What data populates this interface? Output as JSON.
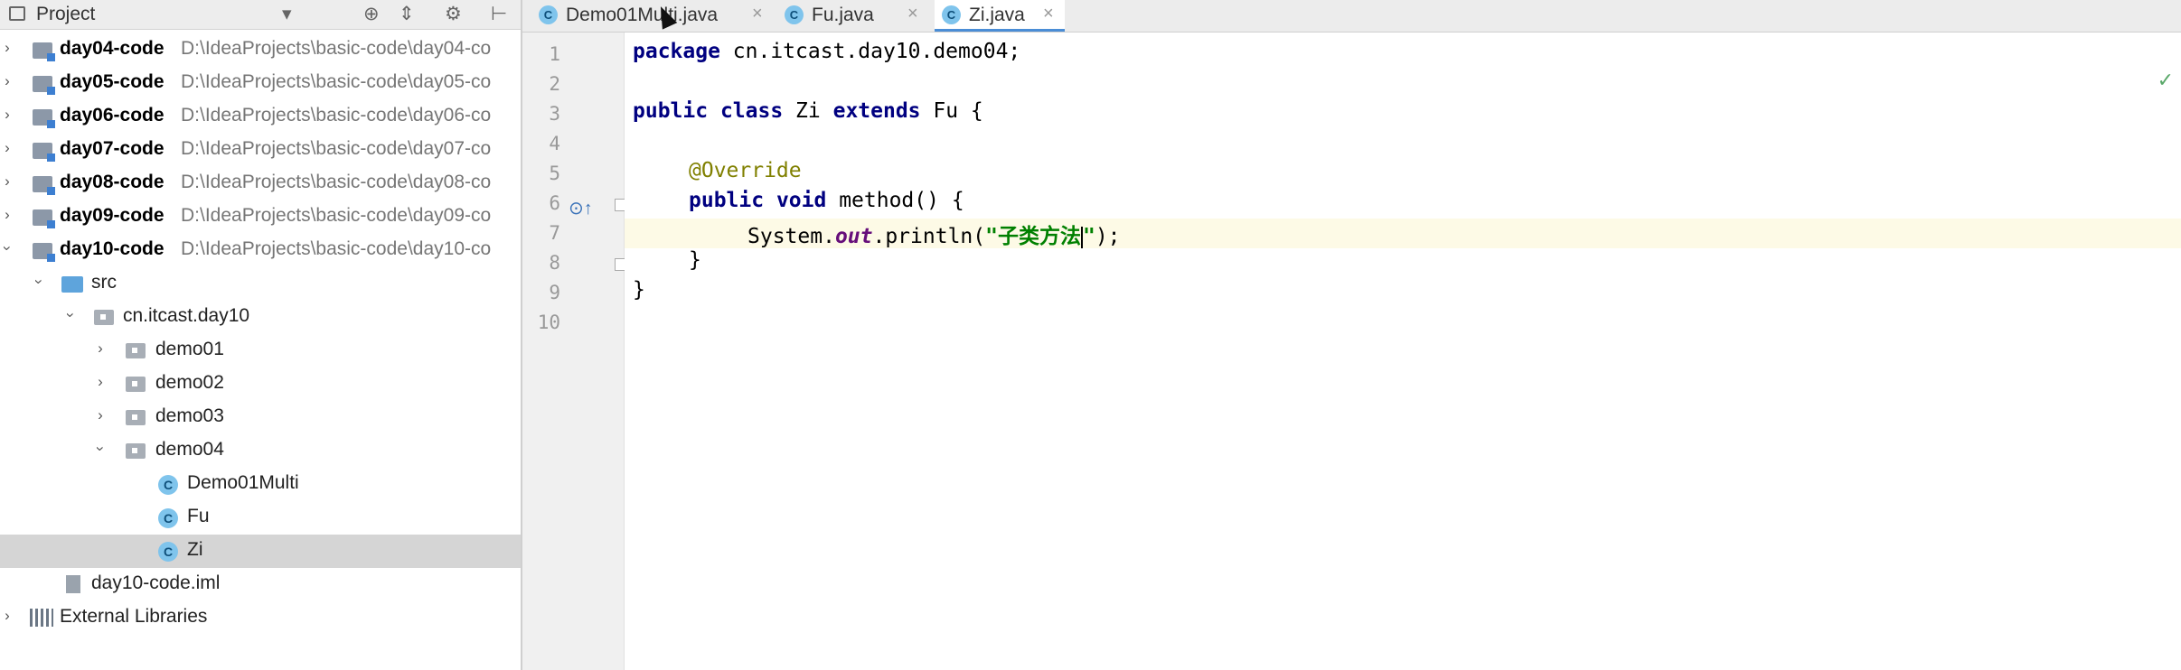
{
  "panel": {
    "title": "Project",
    "dropdown_icon": "caret-down-icon"
  },
  "tree": {
    "modules": [
      {
        "name": "day04-code",
        "path": "D:\\IdeaProjects\\basic-code\\day04-co"
      },
      {
        "name": "day05-code",
        "path": "D:\\IdeaProjects\\basic-code\\day05-co"
      },
      {
        "name": "day06-code",
        "path": "D:\\IdeaProjects\\basic-code\\day06-co"
      },
      {
        "name": "day07-code",
        "path": "D:\\IdeaProjects\\basic-code\\day07-co"
      },
      {
        "name": "day08-code",
        "path": "D:\\IdeaProjects\\basic-code\\day08-co"
      },
      {
        "name": "day09-code",
        "path": "D:\\IdeaProjects\\basic-code\\day09-co"
      },
      {
        "name": "day10-code",
        "path": "D:\\IdeaProjects\\basic-code\\day10-co"
      }
    ],
    "src": "src",
    "package": "cn.itcast.day10",
    "packages": [
      "demo01",
      "demo02",
      "demo03",
      "demo04"
    ],
    "classes": [
      "Demo01Multi",
      "Fu",
      "Zi"
    ],
    "iml": "day10-code.iml",
    "libraries": "External Libraries"
  },
  "tabs": [
    {
      "label": "Demo01Multi.java"
    },
    {
      "label": "Fu.java"
    },
    {
      "label": "Zi.java"
    }
  ],
  "active_tab": "Zi.java",
  "class_badge": "C",
  "code": {
    "line_numbers": [
      "1",
      "2",
      "3",
      "4",
      "5",
      "6",
      "7",
      "8",
      "9",
      "10"
    ],
    "l1_kw": "package",
    "l1_rest": " cn.itcast.day10.demo04;",
    "l3_kw1": "public",
    "l3_kw2": "class",
    "l3_name": " Zi ",
    "l3_kw3": "extends",
    "l3_rest": " Fu {",
    "l5_ann": "@Override",
    "l6_kw1": "public",
    "l6_kw2": "void",
    "l6_rest": " method() {",
    "l7_pre": "System.",
    "l7_field": "out",
    "l7_mid": ".println(",
    "l7_str": "\"子类方法",
    "l7_str_end": "\"",
    "l7_end": ");",
    "l8": "}",
    "l9": "}"
  }
}
